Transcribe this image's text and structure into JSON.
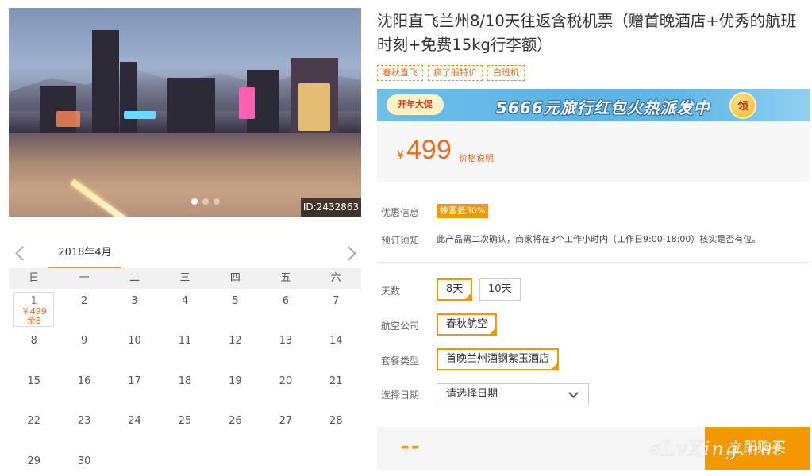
{
  "photo": {
    "id_label": "ID:2432863",
    "slides": 3,
    "active_slide": 1
  },
  "calendar": {
    "month_label": "2018年4月",
    "weekdays": [
      "日",
      "一",
      "二",
      "三",
      "四",
      "五",
      "六"
    ],
    "selected_day": {
      "day": "1",
      "price": "￥499",
      "stock": "余8"
    },
    "days": [
      "2",
      "3",
      "4",
      "5",
      "6",
      "7",
      "8",
      "9",
      "10",
      "11",
      "12",
      "13",
      "14",
      "15",
      "16",
      "17",
      "18",
      "19",
      "20",
      "21",
      "22",
      "23",
      "24",
      "25",
      "26",
      "27",
      "28",
      "29",
      "30"
    ]
  },
  "product": {
    "title": "沈阳直飞兰州8/10天往返含税机票（赠首晚酒店+优秀的航班时刻+免费15kg行李额）",
    "tags": [
      "春秋直飞",
      "疯了般特价",
      "白班机"
    ]
  },
  "banner": {
    "badge": "开年大促",
    "text": "5666元旅行红包火热派发中",
    "claim": "领"
  },
  "price": {
    "currency": "¥",
    "amount": "499",
    "explain_label": "价格说明"
  },
  "info": {
    "promo_label": "优惠信息",
    "promo_value": "蜂蜜抵30%",
    "notice_label": "预订须知",
    "notice_value": "此产品需二次确认，商家将在3个工作小时内（工作日9:00-18:00）核实是否有位。"
  },
  "options": {
    "days_label": "天数",
    "days": [
      "8天",
      "10天"
    ],
    "airline_label": "航空公司",
    "airline": "春秋航空",
    "package_label": "套餐类型",
    "package": "首晚兰州酒钢紫玉酒店",
    "date_label": "选择日期",
    "date_placeholder": "请选择日期"
  },
  "buy": {
    "total_placeholder": "--",
    "button_label": "立即购买"
  },
  "watermark": "eLvXing.net",
  "colors": {
    "accent": "#f39800",
    "price": "#f06a1b",
    "banner": "#5db2e6"
  }
}
